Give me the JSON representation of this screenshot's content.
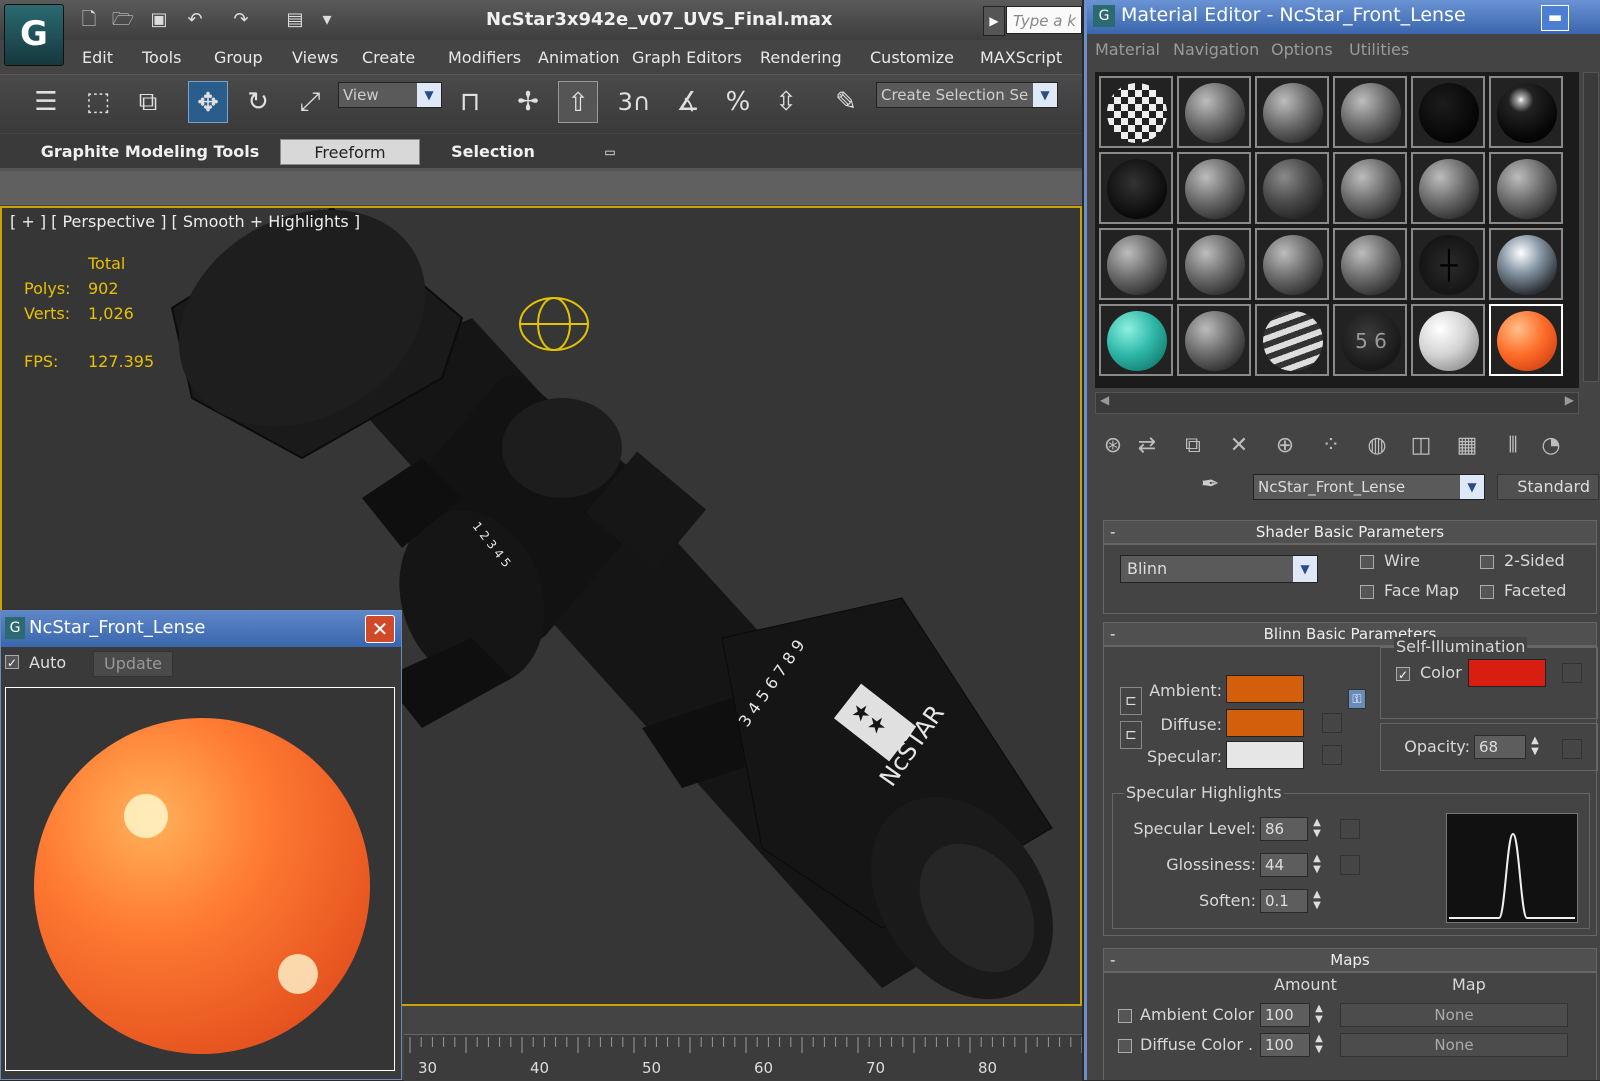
{
  "app": {
    "logo": "G",
    "title": "NcStar3x942e_v07_UVS_Final.max",
    "search_placeholder": "Type a k"
  },
  "menu": [
    "Edit",
    "Tools",
    "Group",
    "Views",
    "Create",
    "Modifiers",
    "Animation",
    "Graph Editors",
    "Rendering",
    "Customize",
    "MAXScript"
  ],
  "toolbar": {
    "view_dropdown": "View",
    "snap_label": "3",
    "selection_set": "Create Selection Se"
  },
  "ribbon": {
    "tabs": [
      "Graphite Modeling Tools",
      "Freeform",
      "Selection"
    ],
    "active_tab": "Freeform"
  },
  "viewport": {
    "label": "[ + ] [ Perspective ] [ Smooth + Highlights ]",
    "stats": {
      "header": "Total",
      "polys_label": "Polys:",
      "polys_value": "902",
      "verts_label": "Verts:",
      "verts_value": "1,026",
      "fps_label": "FPS:",
      "fps_value": "127.395"
    },
    "scope_text": {
      "brand": "NcSTAR",
      "dial_numbers": "3 4 5 6 7 8 9",
      "dial_letters": "1 2 3 4 5"
    }
  },
  "timeline": {
    "ticks": [
      "30",
      "40",
      "50",
      "60",
      "70",
      "80"
    ]
  },
  "preview_window": {
    "title": "NcStar_Front_Lense",
    "auto_label": "Auto",
    "auto_checked": true,
    "update_label": "Update"
  },
  "material_editor": {
    "title": "Material Editor - NcStar_Front_Lense",
    "menu": [
      "Material",
      "Navigation",
      "Options",
      "Utilities"
    ],
    "material_name": "NcStar_Front_Lense",
    "material_type": "Standard",
    "shader_basic": {
      "header": "Shader Basic Parameters",
      "shader": "Blinn",
      "wire": "Wire",
      "two_sided": "2-Sided",
      "face_map": "Face Map",
      "faceted": "Faceted"
    },
    "blinn_basic": {
      "header": "Blinn Basic Parameters",
      "ambient_label": "Ambient:",
      "diffuse_label": "Diffuse:",
      "specular_label": "Specular:",
      "ambient_color": "#d35f0c",
      "diffuse_color": "#d35f0c",
      "specular_color": "#e6e6e6",
      "self_illum_header": "Self-Illumination",
      "self_illum_label": "Color",
      "self_illum_checked": true,
      "self_illum_color": "#d81e10",
      "opacity_label": "Opacity:",
      "opacity_value": "68"
    },
    "specular_highlights": {
      "header": "Specular Highlights",
      "level_label": "Specular Level:",
      "level_value": "86",
      "gloss_label": "Glossiness:",
      "gloss_value": "44",
      "soften_label": "Soften:",
      "soften_value": "0.1"
    },
    "maps": {
      "header": "Maps",
      "amount_header": "Amount",
      "map_header": "Map",
      "rows": [
        {
          "label": "Ambient Color . .",
          "amount": "100",
          "map": "None"
        },
        {
          "label": "Diffuse Color . . .",
          "amount": "100",
          "map": "None"
        }
      ]
    },
    "slot_materials": [
      "checker",
      "gray",
      "gray",
      "gray",
      "black",
      "black-glossy",
      "black-noise",
      "gray",
      "dark-gray",
      "gray",
      "gray",
      "gray",
      "gray",
      "gray",
      "gray",
      "gray",
      "crosshair",
      "chrome",
      "teal",
      "gray",
      "striped",
      "numbered",
      "white",
      "orange"
    ],
    "slot_numbered_text": "5 6"
  },
  "colors": {
    "accent_blue": "#3a66ad",
    "viewport_border": "#c9a400",
    "stats_yellow": "#e8c000"
  }
}
